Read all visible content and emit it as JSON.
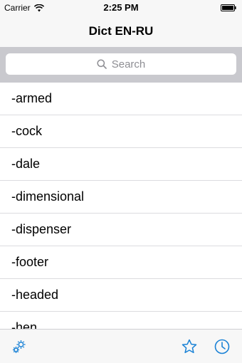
{
  "status_bar": {
    "carrier": "Carrier",
    "time": "2:25 PM"
  },
  "nav": {
    "title": "Dict EN-RU"
  },
  "search": {
    "placeholder": "Search"
  },
  "list": {
    "items": [
      "-armed",
      "-cock",
      "-dale",
      "-dimensional",
      "-dispenser",
      "-footer",
      "-headed",
      "-hen"
    ]
  },
  "tab_bar": {
    "icons": [
      "gears-icon",
      "star-icon",
      "clock-icon"
    ]
  },
  "colors": {
    "accent": "#1a82d6",
    "search_bg": "#c9c9ce",
    "bar_bg": "#f7f7f7",
    "placeholder": "#8e8e93"
  }
}
